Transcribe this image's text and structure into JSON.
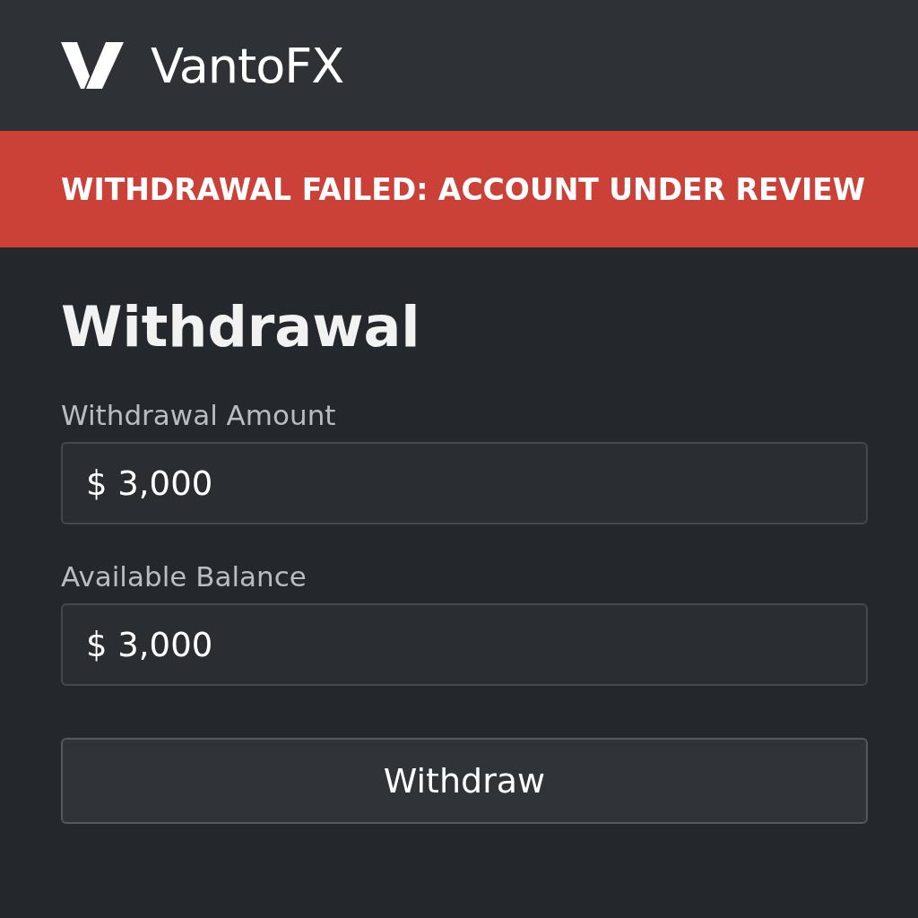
{
  "header": {
    "brand": "VantoFX"
  },
  "alert": {
    "text": "WITHDRAWAL FAILED: ACCOUNT UNDER REVIEW"
  },
  "page_title": "Withdrawal",
  "fields": [
    {
      "label": "Withdrawal Amount",
      "value": "$ 3,000"
    },
    {
      "label": "Available Balance",
      "value": "$ 3,000"
    }
  ],
  "button": {
    "label": "Withdraw"
  }
}
